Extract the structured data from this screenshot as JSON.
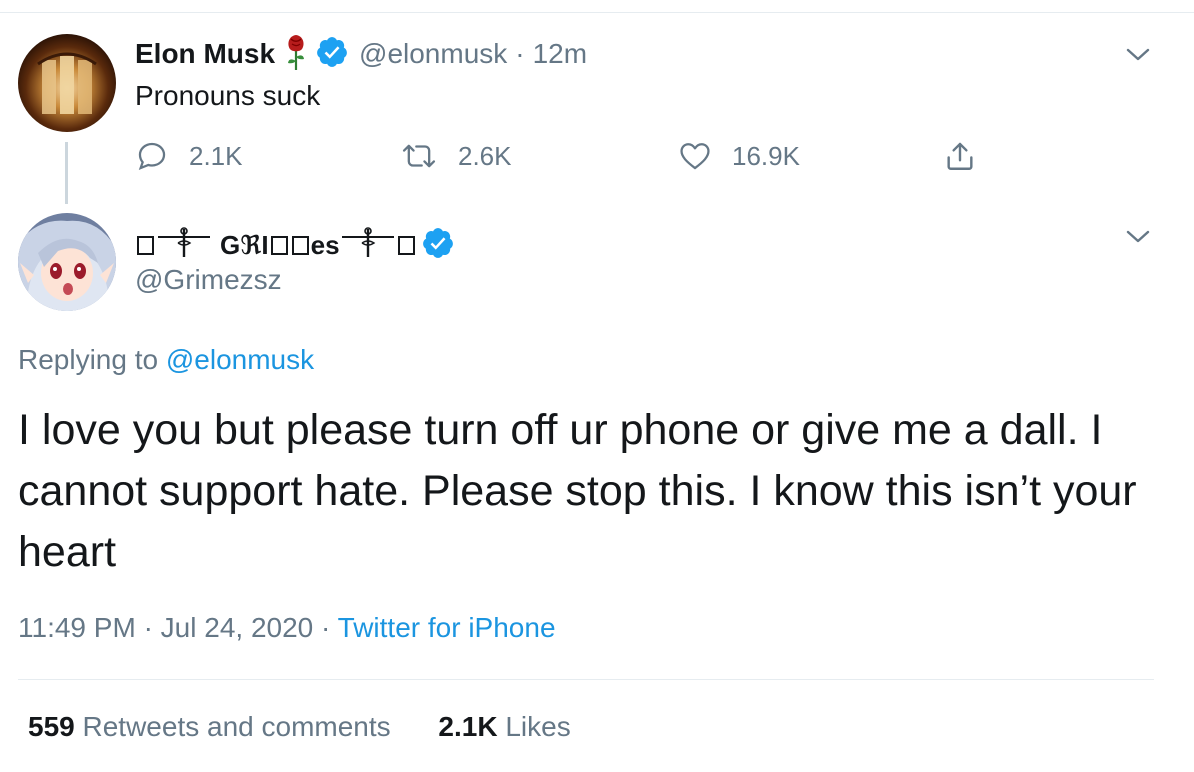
{
  "tweet": {
    "author": {
      "name": "Elon Musk",
      "handle": "@elonmusk",
      "time": "12m",
      "verified": true,
      "emoji_icon": "rose-icon"
    },
    "text": "Pronouns suck",
    "actions": {
      "replies": "2.1K",
      "retweets": "2.6K",
      "likes": "16.9K"
    }
  },
  "reply": {
    "author": {
      "name_parts": [
        "GℜI",
        "es"
      ],
      "handle": "@Grimezsz",
      "verified": true
    },
    "replying_prefix": "Replying to",
    "replying_to": "@elonmusk",
    "text": "I love you but please turn off ur phone or give me a dall. I cannot support hate.  Please stop this. I know this isn’t your heart",
    "time": "11:49 PM",
    "date": "Jul 24, 2020",
    "source": "Twitter for iPhone",
    "stats": {
      "retweets_count": "559",
      "retweets_label": "Retweets and comments",
      "likes_count": "2.1K",
      "likes_label": "Likes"
    }
  },
  "colors": {
    "text": "#14171a",
    "secondary": "#657786",
    "link": "#1b95e0",
    "verified": "#1da1f2",
    "border": "#e6ecf0"
  }
}
